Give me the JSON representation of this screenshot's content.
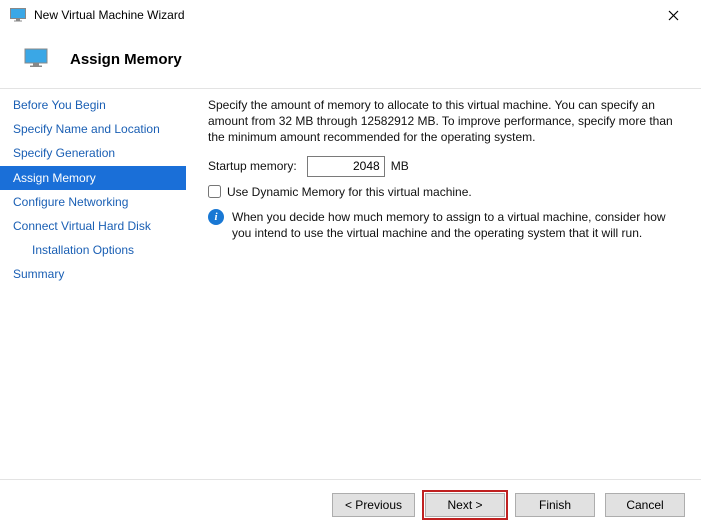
{
  "window": {
    "title": "New Virtual Machine Wizard"
  },
  "header": {
    "title": "Assign Memory"
  },
  "sidebar": {
    "steps": [
      "Before You Begin",
      "Specify Name and Location",
      "Specify Generation",
      "Assign Memory",
      "Configure Networking",
      "Connect Virtual Hard Disk",
      "Installation Options",
      "Summary"
    ]
  },
  "content": {
    "intro": "Specify the amount of memory to allocate to this virtual machine. You can specify an amount from 32 MB through 12582912 MB. To improve performance, specify more than the minimum amount recommended for the operating system.",
    "startup_label": "Startup memory:",
    "startup_value": "2048",
    "startup_unit": "MB",
    "dynamic_label": "Use Dynamic Memory for this virtual machine.",
    "info_text": "When you decide how much memory to assign to a virtual machine, consider how you intend to use the virtual machine and the operating system that it will run."
  },
  "footer": {
    "previous": "< Previous",
    "next": "Next >",
    "finish": "Finish",
    "cancel": "Cancel"
  }
}
